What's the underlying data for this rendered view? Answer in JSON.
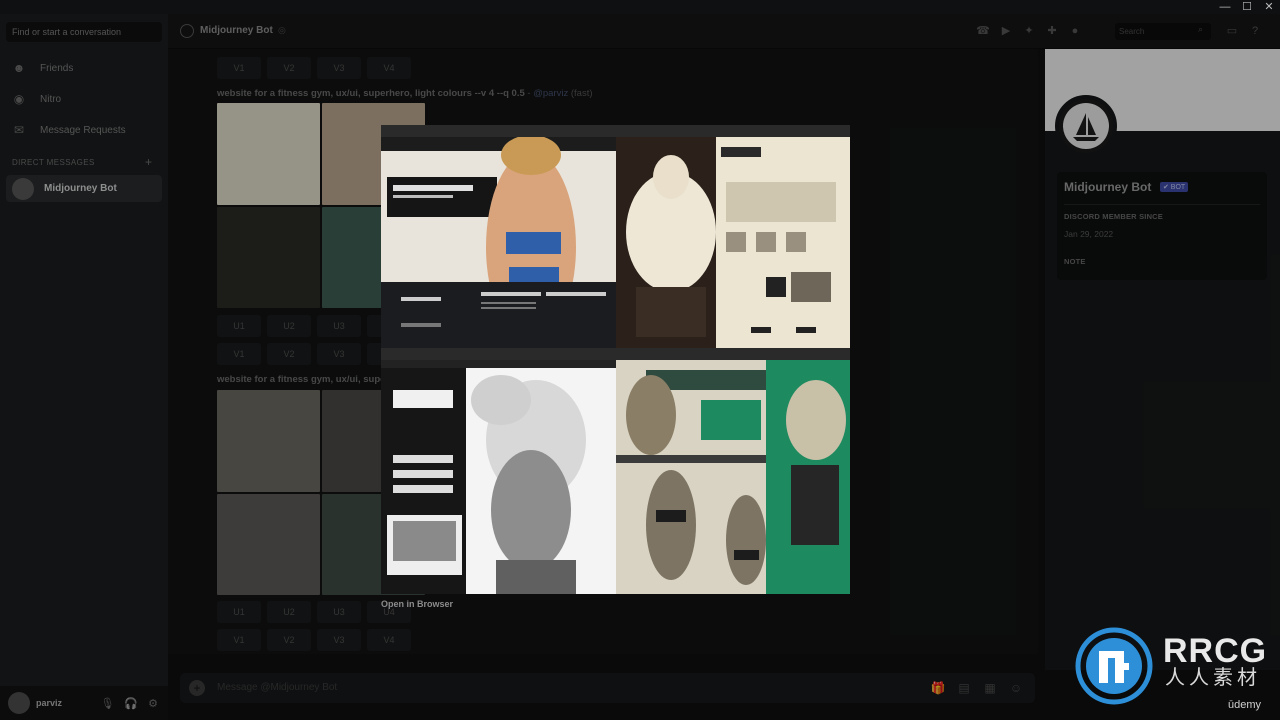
{
  "window": {
    "minimize": "—",
    "maximize": "☐",
    "close": "✕"
  },
  "sidebar": {
    "search_placeholder": "Find or start a conversation",
    "nav": [
      {
        "label": "Friends",
        "icon": "friends-icon"
      },
      {
        "label": "Nitro",
        "icon": "nitro-icon"
      },
      {
        "label": "Message Requests",
        "icon": "message-requests-icon"
      }
    ],
    "dm_header": "DIRECT MESSAGES",
    "dm_add": "+",
    "dm_active": "Midjourney Bot",
    "user": {
      "name": "parviz"
    }
  },
  "topbar": {
    "channel": "Midjourney Bot",
    "status": "◎",
    "search_placeholder": "Search",
    "icons": [
      "call-icon",
      "video-icon",
      "pin-icon",
      "add-member-icon",
      "profile-toggle-icon",
      "inbox-icon",
      "help-icon"
    ]
  },
  "chat": {
    "vrow_top": [
      "V1",
      "V2",
      "V3",
      "V4"
    ],
    "prompt1": {
      "text": "website for a fitness gym, ux/ui, superhero, light colours --v 4 --q 0.5",
      "sep": " - ",
      "mention": "@parviz",
      "speed": " (fast)"
    },
    "urow1": [
      "U1",
      "U2",
      "U3",
      "U4"
    ],
    "vrow1": [
      "V1",
      "V2",
      "V3",
      "V4"
    ],
    "prompt2": {
      "text": "website for a fitness gym, ux/ui, supe"
    },
    "urow2": [
      "U1",
      "U2",
      "U3",
      "U4"
    ],
    "vrow2": [
      "V1",
      "V2",
      "V3",
      "V4"
    ]
  },
  "modal": {
    "open_in_browser": "Open in Browser"
  },
  "profile": {
    "name": "Midjourney Bot",
    "badge": "✔ BOT",
    "member_since_label": "DISCORD MEMBER SINCE",
    "member_since": "Jan 29, 2022",
    "note_label": "NOTE"
  },
  "input": {
    "plus": "+",
    "placeholder": "Message @Midjourney Bot"
  },
  "watermark": {
    "title": "RRCG",
    "subtitle": "人人素材",
    "brand": "ūdemy"
  },
  "colors": {
    "accent": "#3e4aa6",
    "overlay": "#000000",
    "green": "#1e8a5f"
  }
}
